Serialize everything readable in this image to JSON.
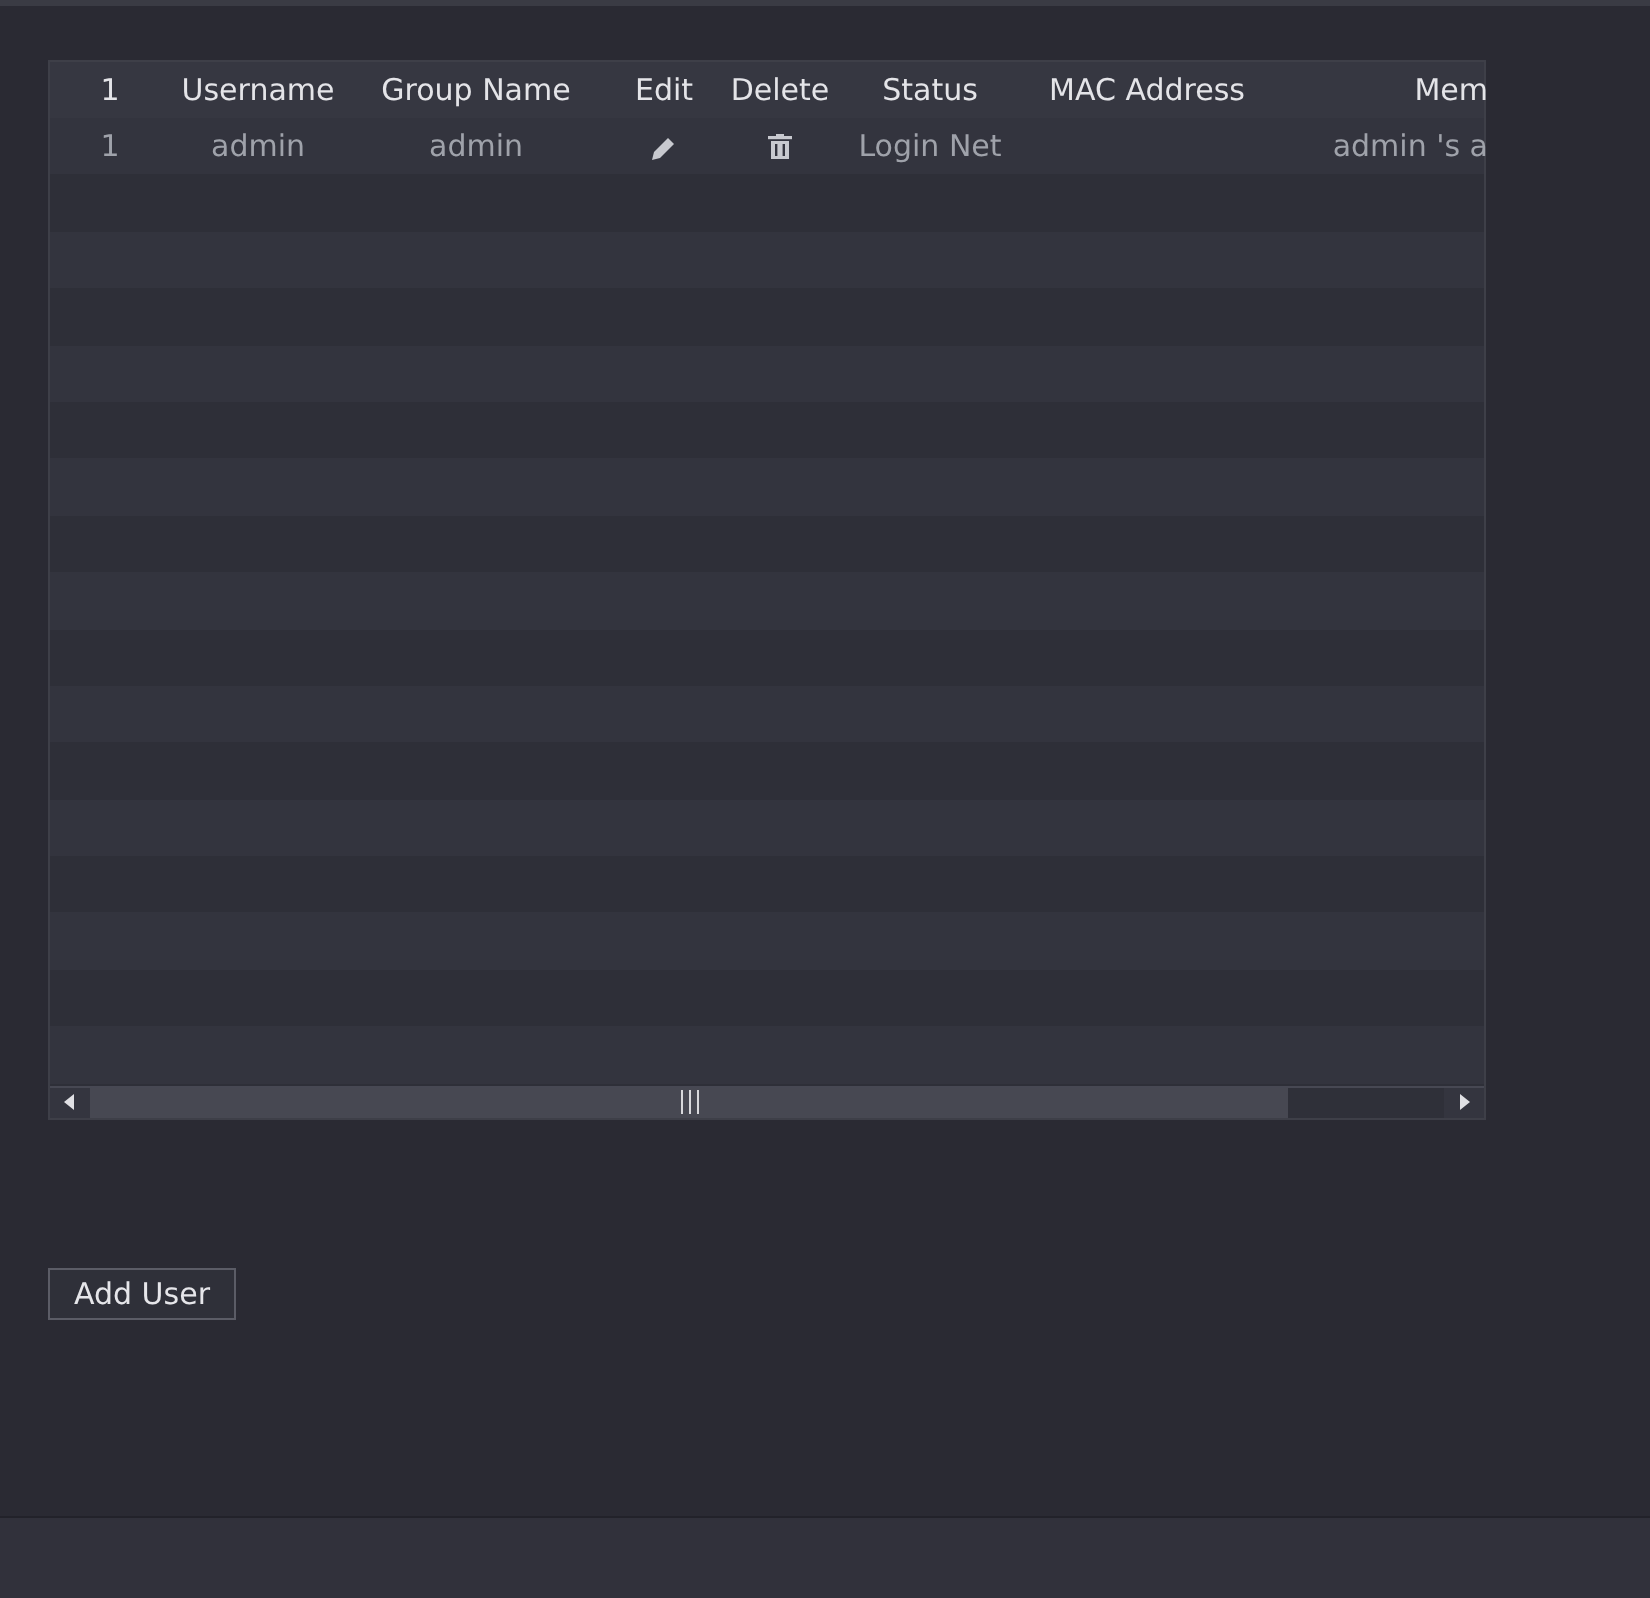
{
  "table": {
    "columns": [
      "1",
      "Username",
      "Group Name",
      "Edit",
      "Delete",
      "Status",
      "MAC Address",
      "Mem"
    ],
    "rows": [
      {
        "index": "1",
        "username": "admin",
        "group_name": "admin",
        "status": "Login Net",
        "mac_address": "",
        "memo": "admin 's a"
      }
    ]
  },
  "add_button": "Add User"
}
